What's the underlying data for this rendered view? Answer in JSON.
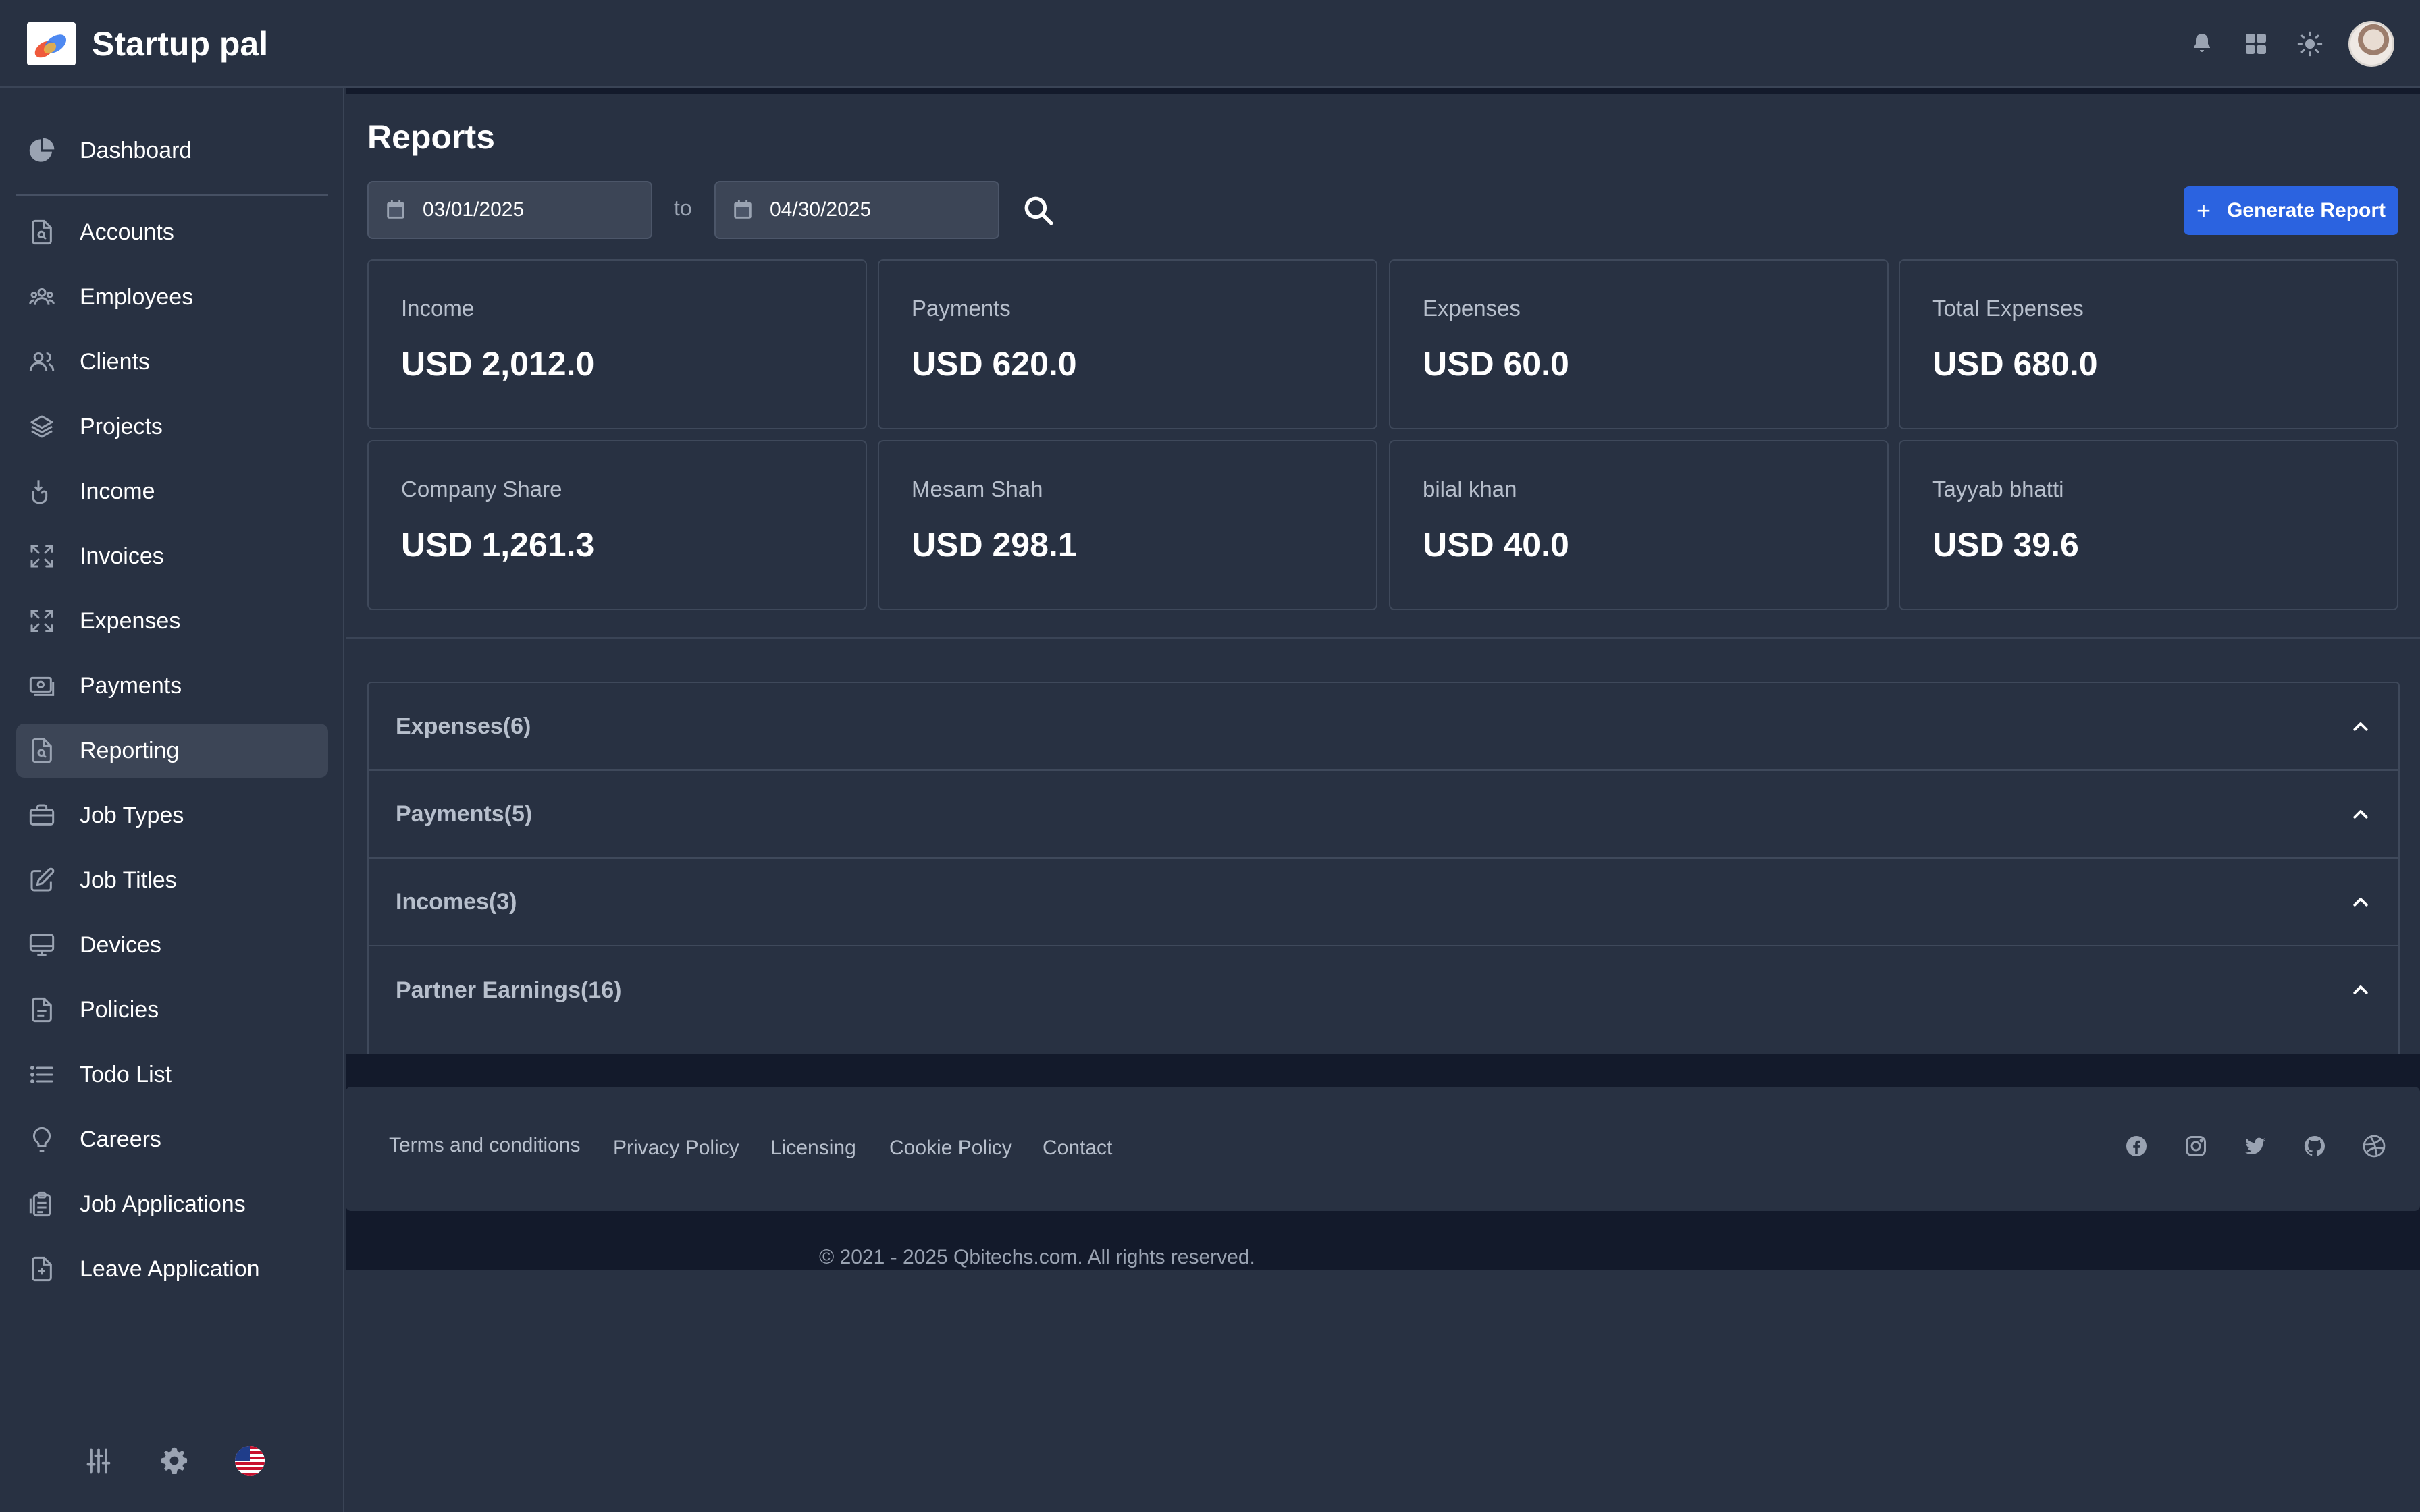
{
  "app": {
    "name": "Startup pal"
  },
  "sidebar": {
    "items": [
      {
        "label": "Dashboard",
        "icon": "pie-chart-icon"
      },
      {
        "label": "Accounts",
        "icon": "document-search-icon"
      },
      {
        "label": "Employees",
        "icon": "users-icon"
      },
      {
        "label": "Clients",
        "icon": "user-group-icon"
      },
      {
        "label": "Projects",
        "icon": "layers-icon"
      },
      {
        "label": "Income",
        "icon": "hand-coin-icon"
      },
      {
        "label": "Invoices",
        "icon": "arrows-expand-icon"
      },
      {
        "label": "Expenses",
        "icon": "arrows-expand-icon"
      },
      {
        "label": "Payments",
        "icon": "cash-icon"
      },
      {
        "label": "Reporting",
        "icon": "document-search-icon",
        "active": true
      },
      {
        "label": "Job Types",
        "icon": "briefcase-icon"
      },
      {
        "label": "Job Titles",
        "icon": "pencil-square-icon"
      },
      {
        "label": "Devices",
        "icon": "desktop-icon"
      },
      {
        "label": "Policies",
        "icon": "document-icon"
      },
      {
        "label": "Todo List",
        "icon": "list-icon"
      },
      {
        "label": "Careers",
        "icon": "lightbulb-icon"
      },
      {
        "label": "Job Applications",
        "icon": "clipboard-icon"
      },
      {
        "label": "Leave Application",
        "icon": "document-plus-icon"
      }
    ]
  },
  "page": {
    "title": "Reports",
    "date_from": "03/01/2025",
    "date_to": "04/30/2025",
    "to_label": "to",
    "generate_label": "Generate Report"
  },
  "cards": [
    {
      "label": "Income",
      "value": "USD 2,012.0"
    },
    {
      "label": "Payments",
      "value": "USD 620.0"
    },
    {
      "label": "Expenses",
      "value": "USD 60.0"
    },
    {
      "label": "Total Expenses",
      "value": "USD 680.0"
    },
    {
      "label": "Company Share",
      "value": "USD 1,261.3"
    },
    {
      "label": "Mesam Shah",
      "value": "USD 298.1"
    },
    {
      "label": "bilal khan",
      "value": "USD 40.0"
    },
    {
      "label": "Tayyab bhatti",
      "value": "USD 39.6"
    }
  ],
  "accordion": [
    {
      "title": "Expenses(6)"
    },
    {
      "title": "Payments(5)"
    },
    {
      "title": "Incomes(3)"
    },
    {
      "title": "Partner Earnings(16)"
    }
  ],
  "footer": {
    "links": [
      "Terms and conditions",
      "Privacy Policy",
      "Licensing",
      "Cookie Policy",
      "Contact"
    ],
    "socials": [
      "facebook-icon",
      "instagram-icon",
      "twitter-icon",
      "github-icon",
      "dribbble-icon"
    ],
    "copyright": "© 2021 - 2025 Qbitechs.com. All rights reserved."
  },
  "colors": {
    "background": "#283142",
    "accent": "#2b63e0",
    "dark_strip": "#131a2b"
  }
}
